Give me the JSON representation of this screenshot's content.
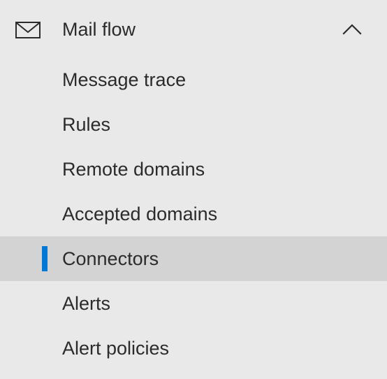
{
  "section": {
    "label": "Mail flow",
    "icon": "mail-icon",
    "toggle_icon": "chevron-up-icon",
    "expanded": true
  },
  "items": [
    {
      "label": "Message trace",
      "selected": false
    },
    {
      "label": "Rules",
      "selected": false
    },
    {
      "label": "Remote domains",
      "selected": false
    },
    {
      "label": "Accepted domains",
      "selected": false
    },
    {
      "label": "Connectors",
      "selected": true
    },
    {
      "label": "Alerts",
      "selected": false
    },
    {
      "label": "Alert policies",
      "selected": false
    }
  ],
  "colors": {
    "background": "#e9e9e9",
    "selected_background": "#d3d3d3",
    "accent": "#0078d4",
    "text": "#2b2b2b"
  }
}
